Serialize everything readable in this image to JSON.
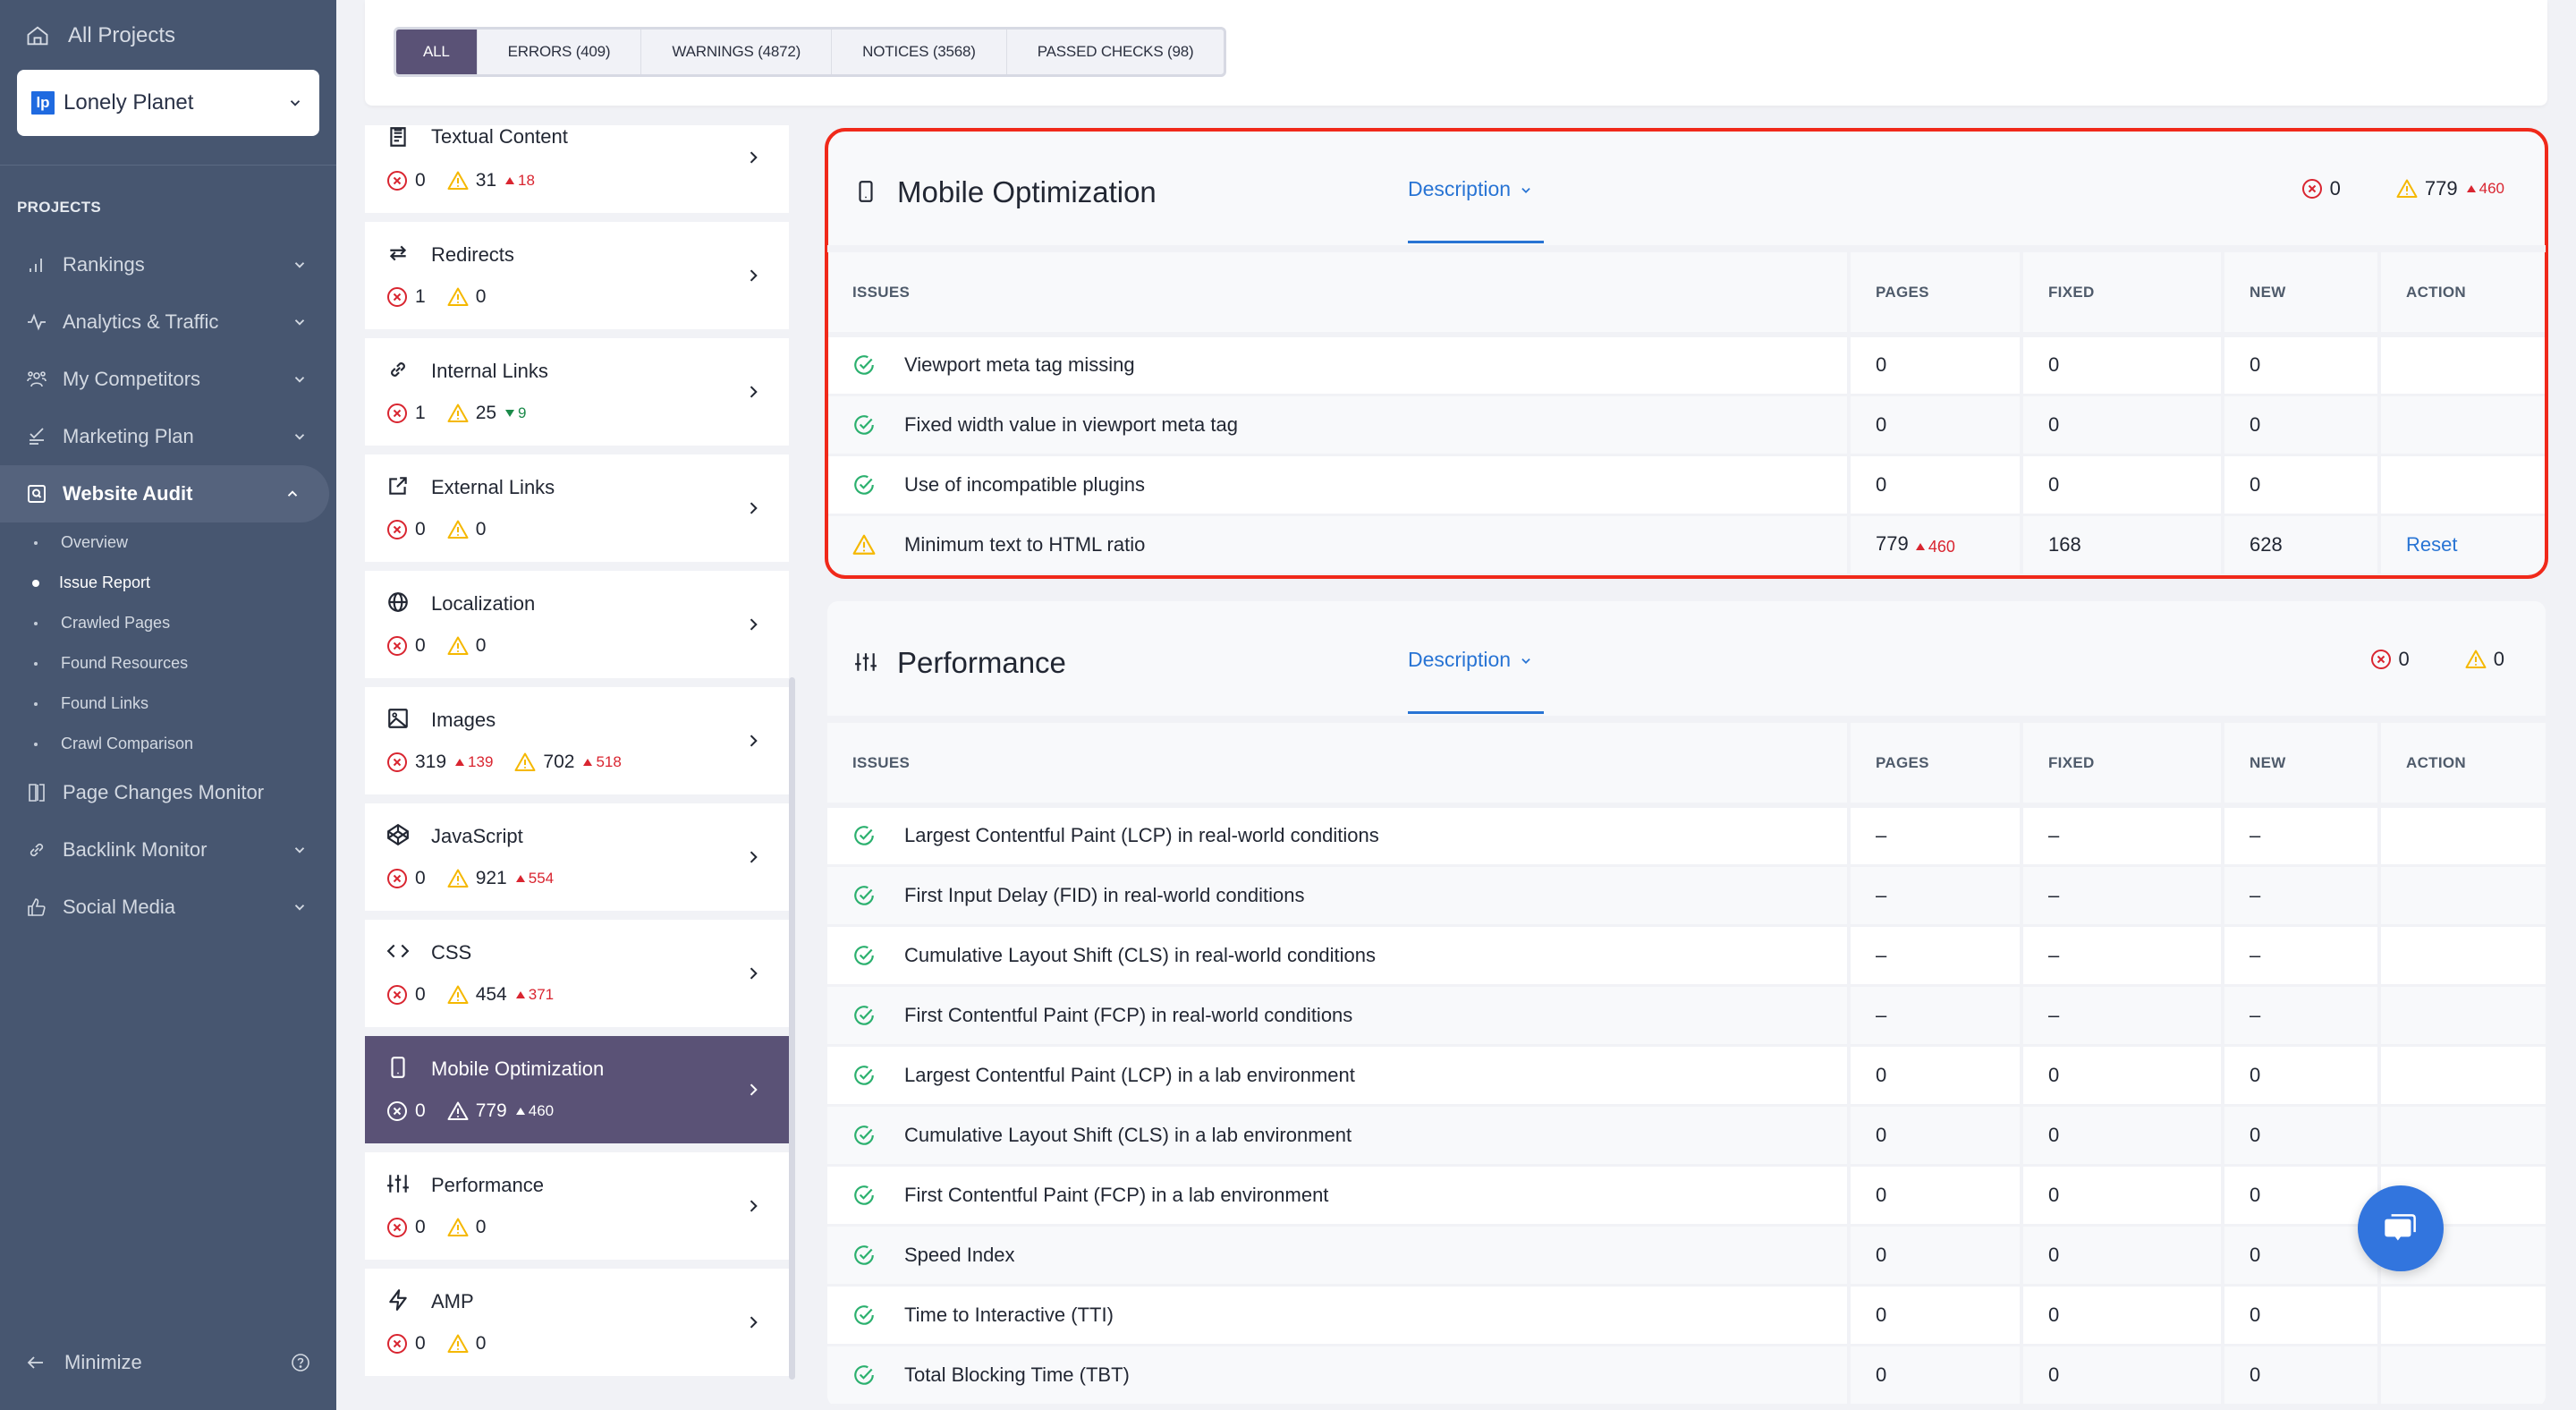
{
  "sidebar": {
    "all_projects": "All Projects",
    "project": {
      "logo": "lp",
      "name": "Lonely Planet",
      "logo_color": "#1f6ae0"
    },
    "section_label": "PROJECTS",
    "items": [
      {
        "label": "Rankings",
        "icon": "bar-chart-icon",
        "expandable": true
      },
      {
        "label": "Analytics & Traffic",
        "icon": "pulse-icon",
        "expandable": true
      },
      {
        "label": "My Competitors",
        "icon": "people-icon",
        "expandable": true
      },
      {
        "label": "Marketing Plan",
        "icon": "checklist-icon",
        "expandable": true
      },
      {
        "label": "Website Audit",
        "icon": "audit-icon",
        "expandable": true,
        "active": true,
        "sub": [
          {
            "label": "Overview"
          },
          {
            "label": "Issue Report",
            "active": true
          },
          {
            "label": "Crawled Pages"
          },
          {
            "label": "Found Resources"
          },
          {
            "label": "Found Links"
          },
          {
            "label": "Crawl Comparison"
          }
        ]
      },
      {
        "label": "Page Changes Monitor",
        "icon": "compare-icon",
        "expandable": false
      },
      {
        "label": "Backlink Monitor",
        "icon": "link-icon",
        "expandable": true
      },
      {
        "label": "Social Media",
        "icon": "thumbs-up-icon",
        "expandable": true
      }
    ],
    "minimize": "Minimize"
  },
  "filters": [
    {
      "label": "ALL",
      "active": true
    },
    {
      "label": "ERRORS (409)"
    },
    {
      "label": "WARNINGS (4872)"
    },
    {
      "label": "NOTICES (3568)"
    },
    {
      "label": "PASSED CHECKS (98)"
    }
  ],
  "categories": [
    {
      "title": "Textual Content",
      "icon": "document-icon",
      "errors": "0",
      "warnings": "31",
      "warnings_delta": "18",
      "warnings_delta_dir": "up"
    },
    {
      "title": "Redirects",
      "icon": "redirect-icon",
      "errors": "1",
      "warnings": "0"
    },
    {
      "title": "Internal Links",
      "icon": "link-icon",
      "errors": "1",
      "warnings": "25",
      "warnings_delta": "9",
      "warnings_delta_dir": "down"
    },
    {
      "title": "External Links",
      "icon": "external-link-icon",
      "errors": "0",
      "warnings": "0"
    },
    {
      "title": "Localization",
      "icon": "globe-icon",
      "errors": "0",
      "warnings": "0"
    },
    {
      "title": "Images",
      "icon": "image-icon",
      "errors": "319",
      "errors_delta": "139",
      "errors_delta_dir": "up",
      "warnings": "702",
      "warnings_delta": "518",
      "warnings_delta_dir": "up"
    },
    {
      "title": "JavaScript",
      "icon": "codepen-icon",
      "errors": "0",
      "warnings": "921",
      "warnings_delta": "554",
      "warnings_delta_dir": "up"
    },
    {
      "title": "CSS",
      "icon": "code-icon",
      "errors": "0",
      "warnings": "454",
      "warnings_delta": "371",
      "warnings_delta_dir": "up"
    },
    {
      "title": "Mobile Optimization",
      "icon": "mobile-icon",
      "errors": "0",
      "warnings": "779",
      "warnings_delta": "460",
      "warnings_delta_dir": "up",
      "active": true
    },
    {
      "title": "Performance",
      "icon": "sliders-icon",
      "errors": "0",
      "warnings": "0"
    },
    {
      "title": "AMP",
      "icon": "lightning-icon",
      "errors": "0",
      "warnings": "0"
    }
  ],
  "panels": [
    {
      "id": "mobile",
      "title": "Mobile Optimization",
      "icon": "mobile-icon",
      "description_label": "Description",
      "errors": "0",
      "warnings": "779",
      "warnings_delta": "460",
      "columns": [
        "ISSUES",
        "PAGES",
        "FIXED",
        "NEW",
        "ACTION"
      ],
      "rows": [
        {
          "status": "passed",
          "issue": "Viewport meta tag missing",
          "pages": "0",
          "fixed": "0",
          "new": "0",
          "action": ""
        },
        {
          "status": "passed",
          "issue": "Fixed width value in viewport meta tag",
          "pages": "0",
          "fixed": "0",
          "new": "0",
          "action": ""
        },
        {
          "status": "passed",
          "issue": "Use of incompatible plugins",
          "pages": "0",
          "fixed": "0",
          "new": "0",
          "action": ""
        },
        {
          "status": "warning",
          "issue": "Minimum text to HTML ratio",
          "pages": "779",
          "pages_delta": "460",
          "fixed": "168",
          "new": "628",
          "action": "Reset"
        }
      ]
    },
    {
      "id": "performance",
      "title": "Performance",
      "icon": "sliders-icon",
      "description_label": "Description",
      "errors": "0",
      "warnings": "0",
      "columns": [
        "ISSUES",
        "PAGES",
        "FIXED",
        "NEW",
        "ACTION"
      ],
      "rows": [
        {
          "status": "passed",
          "issue": "Largest Contentful Paint (LCP) in real-world conditions",
          "pages": "–",
          "fixed": "–",
          "new": "–",
          "action": ""
        },
        {
          "status": "passed",
          "issue": "First Input Delay (FID) in real-world conditions",
          "pages": "–",
          "fixed": "–",
          "new": "–",
          "action": ""
        },
        {
          "status": "passed",
          "issue": "Cumulative Layout Shift (CLS) in real-world conditions",
          "pages": "–",
          "fixed": "–",
          "new": "–",
          "action": ""
        },
        {
          "status": "passed",
          "issue": "First Contentful Paint (FCP) in real-world conditions",
          "pages": "–",
          "fixed": "–",
          "new": "–",
          "action": ""
        },
        {
          "status": "passed",
          "issue": "Largest Contentful Paint (LCP) in a lab environment",
          "pages": "0",
          "fixed": "0",
          "new": "0",
          "action": ""
        },
        {
          "status": "passed",
          "issue": "Cumulative Layout Shift (CLS) in a lab environment",
          "pages": "0",
          "fixed": "0",
          "new": "0",
          "action": ""
        },
        {
          "status": "passed",
          "issue": "First Contentful Paint (FCP) in a lab environment",
          "pages": "0",
          "fixed": "0",
          "new": "0",
          "action": ""
        },
        {
          "status": "passed",
          "issue": "Speed Index",
          "pages": "0",
          "fixed": "0",
          "new": "0",
          "action": ""
        },
        {
          "status": "passed",
          "issue": "Time to Interactive (TTI)",
          "pages": "0",
          "fixed": "0",
          "new": "0",
          "action": ""
        },
        {
          "status": "passed",
          "issue": "Total Blocking Time (TBT)",
          "pages": "0",
          "fixed": "0",
          "new": "0",
          "action": ""
        }
      ]
    }
  ],
  "colors": {
    "sidebar_bg": "#475670",
    "accent_purple": "#5a5276",
    "error_red": "#d92530",
    "warning_yellow": "#f5b800",
    "passed_green": "#2bb06e",
    "link_blue": "#2874d4",
    "highlight_border": "#f0291a"
  },
  "chat_button": {
    "icon": "chat-icon"
  }
}
